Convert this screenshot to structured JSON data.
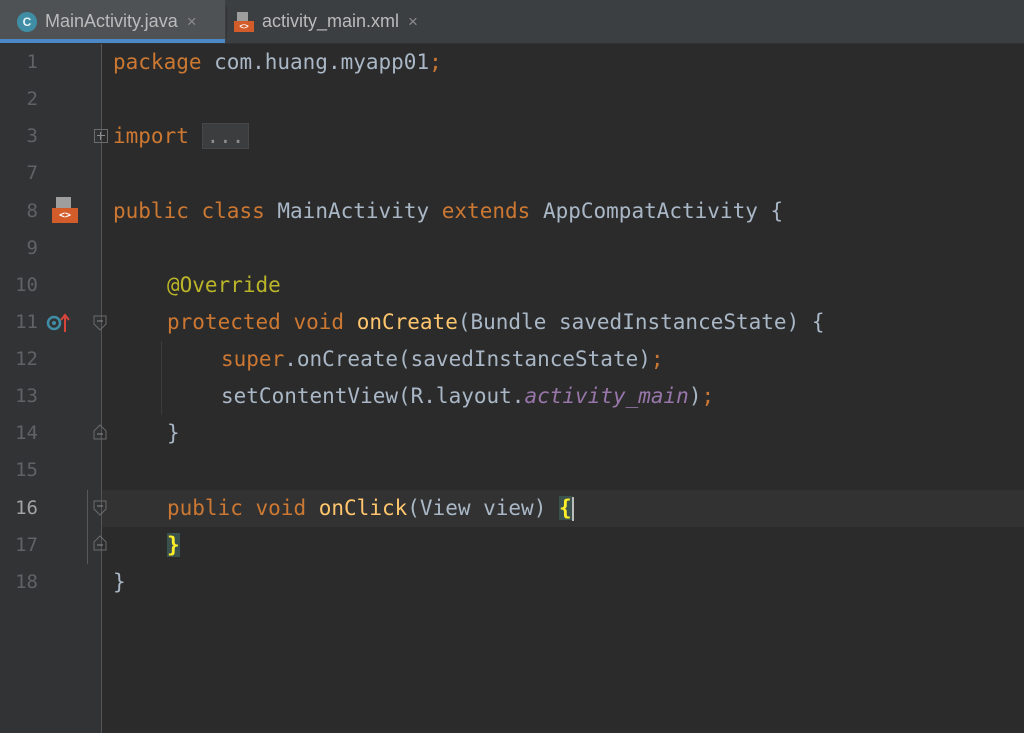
{
  "tabs": [
    {
      "label": "MainActivity.java",
      "icon": "java-class-icon",
      "icon_text": "C",
      "active": true
    },
    {
      "label": "activity_main.xml",
      "icon": "xml-layout-icon",
      "icon_text": "<>",
      "active": false
    }
  ],
  "tab_close_glyph": "×",
  "editor": {
    "line_numbers": [
      "1",
      "2",
      "3",
      "7",
      "8",
      "9",
      "10",
      "11",
      "12",
      "13",
      "14",
      "15",
      "16",
      "17",
      "18"
    ],
    "current_line": "16",
    "lines": {
      "l1": {
        "kw": "package",
        "rest": " com.huang.myapp01",
        "semi": ";"
      },
      "l3": {
        "kw": "import",
        "fold": "..."
      },
      "l8": {
        "kw1": "public",
        "kw2": "class",
        "name": "MainActivity",
        "kw3": "extends",
        "parent": "AppCompatActivity",
        "brace": "{"
      },
      "l10": {
        "annotation": "@Override"
      },
      "l11": {
        "kw1": "protected",
        "kw2": "void",
        "fn": "onCreate",
        "params": "(Bundle savedInstanceState) {"
      },
      "l12": {
        "kw": "super",
        "rest": ".onCreate(savedInstanceState)",
        "semi": ";"
      },
      "l13": {
        "pre": "setContentView(R.layout.",
        "field": "activity_main",
        "post": ")",
        "semi": ";"
      },
      "l14": {
        "brace": "}"
      },
      "l16": {
        "kw1": "public",
        "kw2": "void",
        "fn": "onClick",
        "params": "(View view) ",
        "brace": "{"
      },
      "l17": {
        "brace": "}"
      },
      "l18": {
        "brace": "}"
      }
    },
    "xml_gutter_text": "<>"
  },
  "colors": {
    "background": "#2b2b2b",
    "keyword": "#cc7832",
    "annotation": "#bbb529",
    "function": "#ffc66d",
    "field": "#9876aa",
    "text": "#a9b7c6"
  }
}
